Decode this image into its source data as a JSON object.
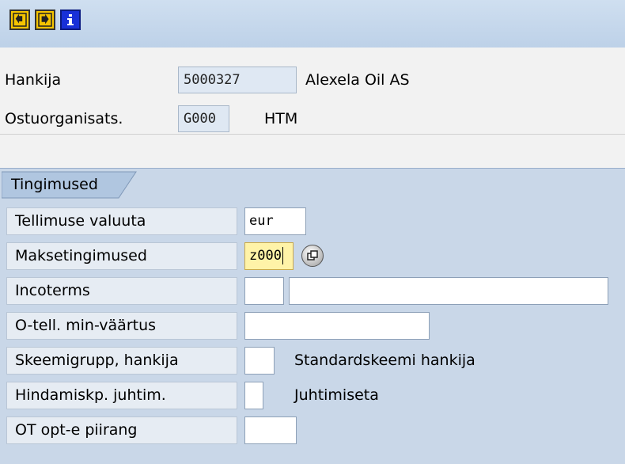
{
  "toolbar": {
    "buttons": [
      {
        "name": "back",
        "icon": "arrow-left-icon"
      },
      {
        "name": "forward",
        "icon": "arrow-right-icon"
      },
      {
        "name": "info",
        "icon": "info-icon"
      }
    ]
  },
  "header": {
    "vendor_label": "Hankija",
    "vendor_value": "5000327",
    "vendor_name": "Alexela Oil AS",
    "purch_org_label": "Ostuorganisats.",
    "purch_org_value": "G000",
    "purch_org_name": "HTM"
  },
  "conditions": {
    "tab_label": "Tingimused",
    "currency_label": "Tellimuse valuuta",
    "currency_value": "eur",
    "payment_terms_label": "Maksetingimused",
    "payment_terms_value": "z000",
    "incoterms_label": "Incoterms",
    "incoterms_value1": "",
    "incoterms_value2": "",
    "min_order_label": "O-tell. min-väärtus",
    "min_order_value": "",
    "schema_group_label": "Skeemigrupp, hankija",
    "schema_group_value": "",
    "schema_group_desc": "Standardskeemi hankija",
    "pricing_control_label": "Hindamiskp. juhtim.",
    "pricing_control_value": "",
    "pricing_control_desc": "Juhtimiseta",
    "ot_limit_label": "OT opt-e piirang",
    "ot_limit_value": ""
  },
  "colors": {
    "toolbar_bg": "#c5d7ec",
    "panel_bg": "#c9d7e8",
    "focus_field": "#fff3a8",
    "button_yellow": "#f5c400",
    "button_blue": "#1830d8"
  }
}
